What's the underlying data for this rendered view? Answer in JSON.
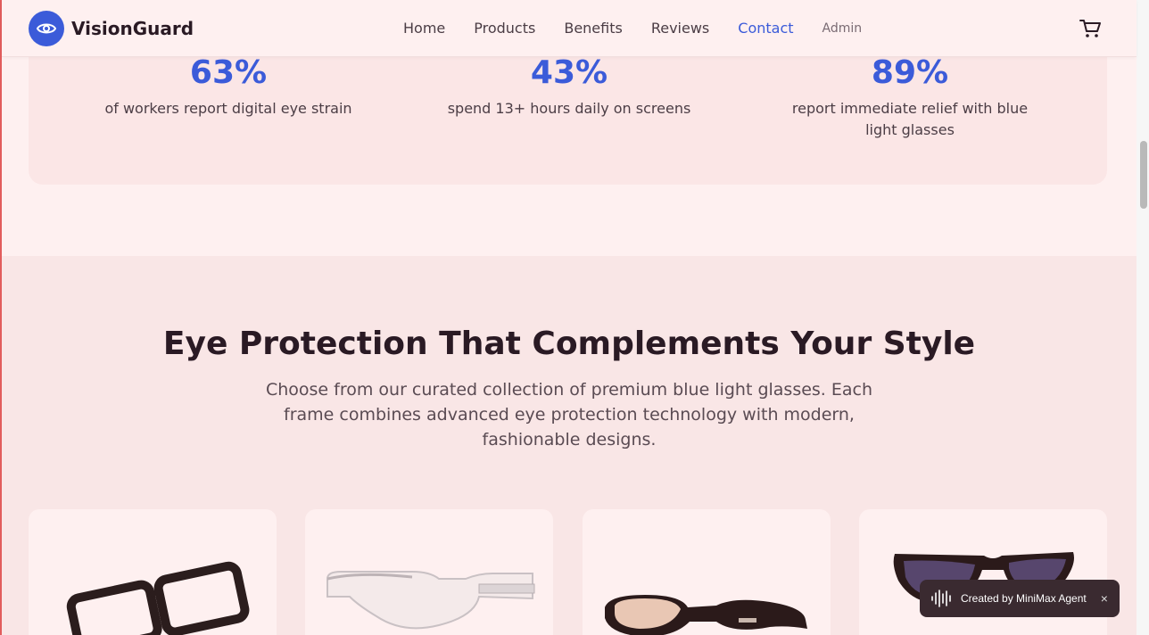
{
  "header": {
    "brand": "VisionGuard",
    "nav": {
      "home": "Home",
      "products": "Products",
      "benefits": "Benefits",
      "reviews": "Reviews",
      "contact": "Contact",
      "admin": "Admin"
    },
    "active_nav": "Contact",
    "accent_color": "#3b5bd9"
  },
  "stats": [
    {
      "value": "63%",
      "label": "of workers report digital eye strain"
    },
    {
      "value": "43%",
      "label": "spend 13+ hours daily on screens"
    },
    {
      "value": "89%",
      "label": "report immediate relief with blue light glasses"
    }
  ],
  "products_section": {
    "title": "Eye Protection That Complements Your Style",
    "subtitle": "Choose from our curated collection of premium blue light glasses. Each frame combines advanced eye protection technology with modern, fashionable designs.",
    "cards": [
      {
        "icon": "dark-square-glasses-image"
      },
      {
        "icon": "clear-frame-glasses-image"
      },
      {
        "icon": "black-sport-glasses-image"
      },
      {
        "icon": "cat-eye-glasses-image"
      }
    ]
  },
  "badge": {
    "text": "Created by MiniMax Agent",
    "close": "×"
  }
}
